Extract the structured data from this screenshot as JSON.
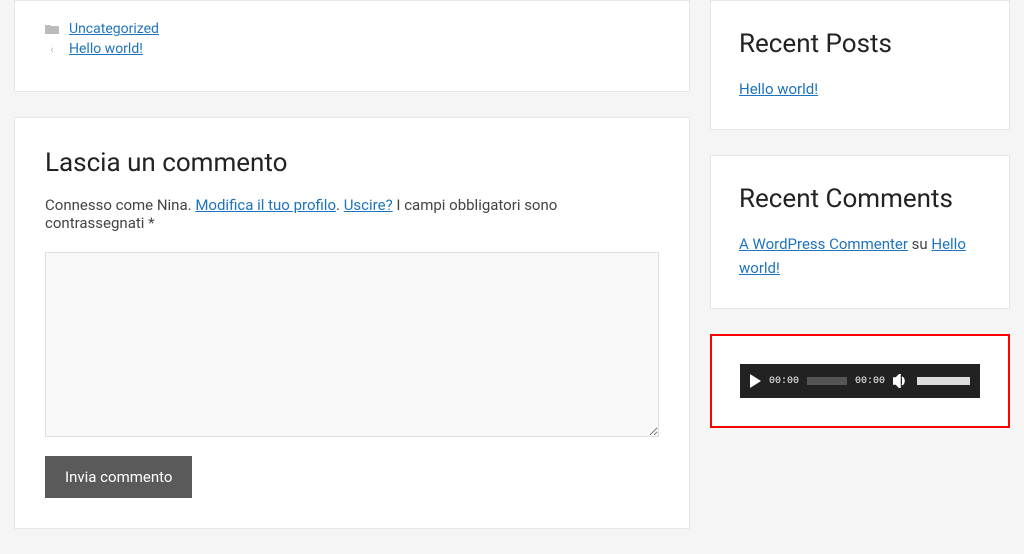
{
  "meta": {
    "category_label": "Uncategorized",
    "prev_post_label": "Hello world!"
  },
  "comment_form": {
    "title": "Lascia un commento",
    "logged_in_prefix": "Connesso come Nina. ",
    "edit_profile": "Modifica il tuo profilo",
    "separator": ". ",
    "logout": "Uscire?",
    "required_note": " I campi obbligatori sono contrassegnati *",
    "submit_label": "Invia commento"
  },
  "sidebar": {
    "recent_posts": {
      "title": "Recent Posts",
      "items": [
        "Hello world!"
      ]
    },
    "recent_comments": {
      "title": "Recent Comments",
      "author": "A WordPress Commenter",
      "on": " su ",
      "post": "Hello world!"
    },
    "audio": {
      "current_time": "00:00",
      "duration": "00:00"
    }
  }
}
